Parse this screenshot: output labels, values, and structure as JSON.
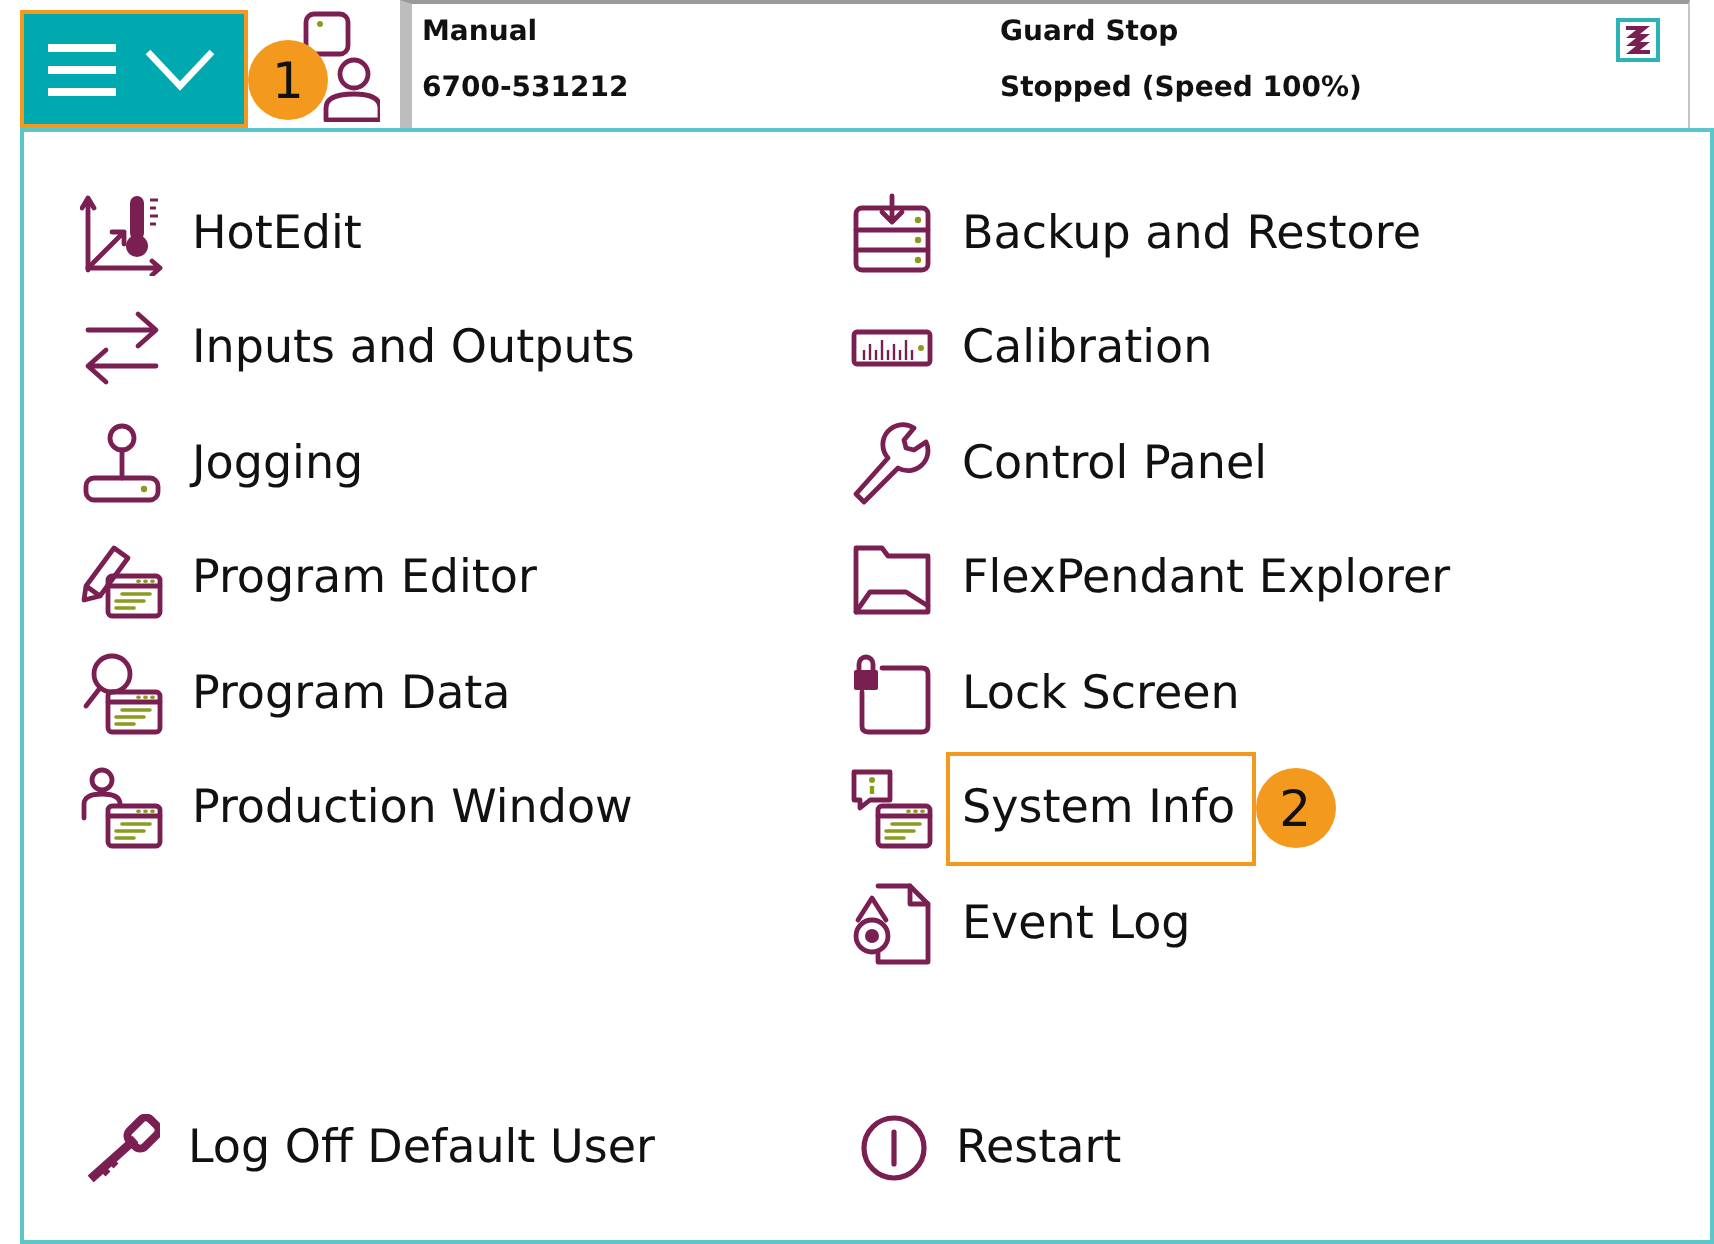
{
  "top_bar": {
    "menu_button": {
      "highlighted": true,
      "callout": "1"
    },
    "status": [
      {
        "line_1": "Manual",
        "line_2": "6700-531212"
      },
      {
        "line_1": "Guard Stop",
        "line_2": "Stopped (Speed 100%)"
      }
    ]
  },
  "menu": {
    "columns": [
      {
        "items": [
          {
            "label": "HotEdit",
            "highlighted": false
          },
          {
            "label": "Inputs and Outputs",
            "highlighted": false
          },
          {
            "label": "Jogging",
            "highlighted": false
          },
          {
            "label": "Program Editor",
            "highlighted": false
          },
          {
            "label": "Program Data",
            "highlighted": false
          },
          {
            "label": "Production Window",
            "highlighted": false
          }
        ]
      },
      {
        "items": [
          {
            "label": "Backup and Restore",
            "highlighted": false
          },
          {
            "label": "Calibration",
            "highlighted": false
          },
          {
            "label": "Control Panel",
            "highlighted": false
          },
          {
            "label": "FlexPendant Explorer",
            "highlighted": false
          },
          {
            "label": "Lock Screen",
            "highlighted": false
          },
          {
            "label": "System Info",
            "highlighted": true,
            "callout": "2"
          },
          {
            "label": "Event Log",
            "highlighted": false
          }
        ]
      }
    ]
  },
  "bottom_actions": [
    {
      "label": "Log Off Default User"
    },
    {
      "label": "Restart"
    }
  ]
}
